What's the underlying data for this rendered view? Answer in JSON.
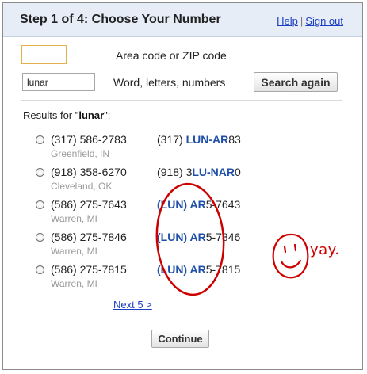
{
  "header": {
    "title": "Step 1 of 4: Choose Your Number",
    "help_label": "Help",
    "separator": "|",
    "signout_label": "Sign out"
  },
  "search": {
    "area_value": "",
    "area_label": "Area code or ZIP code",
    "word_value": "lunar",
    "word_label": "Word, letters, numbers",
    "button_label": "Search again"
  },
  "results": {
    "prefix": "Results for \"",
    "query": "lunar",
    "suffix": "\":",
    "items": [
      {
        "number": "(317) 586-2783",
        "location": "Greenfield, IN",
        "vanity_pre": "(317) ",
        "vanity_hl": "LUN-AR",
        "vanity_post": "83"
      },
      {
        "number": "(918) 358-6270",
        "location": "Cleveland, OK",
        "vanity_pre": "(918) 3",
        "vanity_hl": "LU-NAR",
        "vanity_post": "0"
      },
      {
        "number": "(586) 275-7643",
        "location": "Warren, MI",
        "vanity_pre": "",
        "vanity_hl": "(LUN) AR",
        "vanity_post": "5-7643"
      },
      {
        "number": "(586) 275-7846",
        "location": "Warren, MI",
        "vanity_pre": "",
        "vanity_hl": "(LUN) AR",
        "vanity_post": "5-7846"
      },
      {
        "number": "(586) 275-7815",
        "location": "Warren, MI",
        "vanity_pre": "",
        "vanity_hl": "(LUN) AR",
        "vanity_post": "5-7815"
      }
    ]
  },
  "next_label": "Next 5 >",
  "continue_label": "Continue",
  "annotation": {
    "text": "yay.",
    "color": "#cc0000"
  },
  "colors": {
    "header_bg": "#e7edf7",
    "link": "#1a3fc2",
    "highlight": "#1f4fa8"
  }
}
